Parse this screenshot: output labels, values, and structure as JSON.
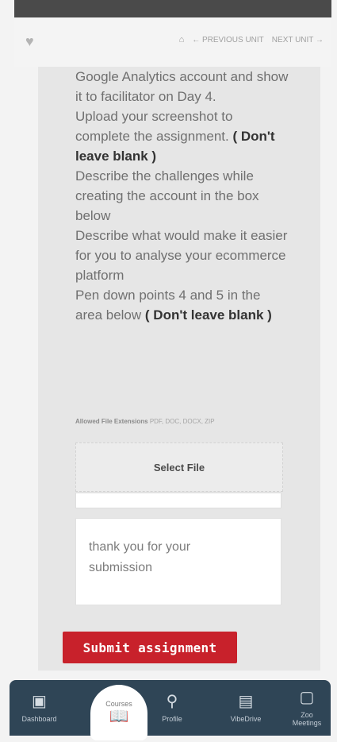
{
  "header": {
    "logo_text": "",
    "home_icon": "home-icon",
    "previous_unit": "← PREVIOUS UNIT",
    "next_unit": "NEXT UNIT →"
  },
  "content": {
    "line_1": "Google Analytics account and show it to facilitator on Day 4.",
    "line_2": "Upload your screenshot to complete the assignment.",
    "bold_1": "( Don't leave blank )",
    "line_3": "Describe the challenges while creating the account in the box below",
    "line_4": "Describe what would make it easier for you to analyse your ecommerce platform",
    "line_5": "Pen down points 4 and 5  in the area below",
    "bold_2": "( Don't leave blank )"
  },
  "upload": {
    "allowed_label": "Allowed File Extensions",
    "allowed_types": "PDF, DOC, DOCX, ZIP",
    "select_file": "Select File"
  },
  "textarea": {
    "value": "thank you for your submission"
  },
  "submit": {
    "label": "Submit assignment"
  },
  "bottom_nav": {
    "dashboard": "Dashboard",
    "courses": "Courses",
    "profile": "Profile",
    "vibedrive": "VibeDrive",
    "meetings": "Meetings",
    "meetings_badge": "Zoo"
  },
  "colors": {
    "accent": "#c8212b",
    "nav_bg": "#2f4556"
  }
}
